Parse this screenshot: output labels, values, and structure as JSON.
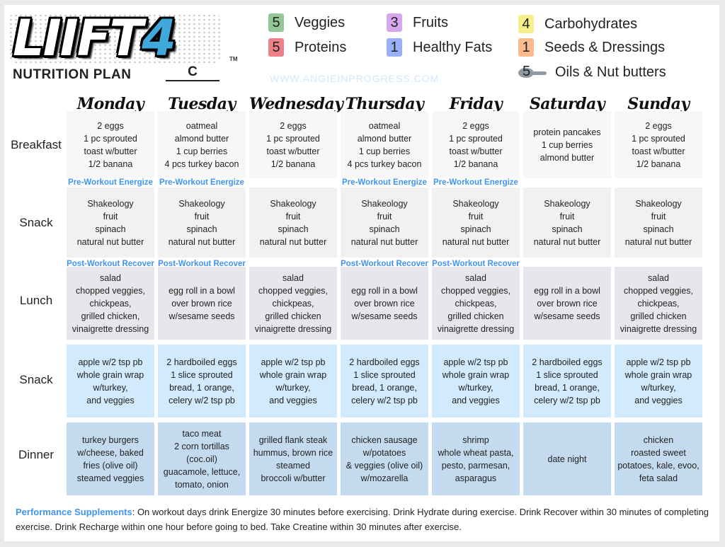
{
  "header": {
    "logo_main": "LIIFT",
    "logo_number": "4",
    "logo_tm": "TM",
    "plan_label": "NUTRITION PLAN",
    "plan_value": "C",
    "website": "WWW.ANGIEINPROGRESS.COM"
  },
  "legend": [
    {
      "count": "5",
      "label": "Veggies",
      "color": "#93c795"
    },
    {
      "count": "3",
      "label": "Fruits",
      "color": "#d7a7ec"
    },
    {
      "count": "4",
      "label": "Carbohydrates",
      "color": "#f5f08b"
    },
    {
      "count": "5",
      "label": "Proteins",
      "color": "#ee8089"
    },
    {
      "count": "1",
      "label": "Healthy Fats",
      "color": "#9aaff7"
    },
    {
      "count": "1",
      "label": "Seeds & Dressings",
      "color": "#fcbb8f"
    },
    {
      "count": "5",
      "label": "Oils & Nut butters",
      "color": "#8e9ba5"
    }
  ],
  "days": [
    "Monday",
    "Tuesday",
    "Wednesday",
    "Thursday",
    "Friday",
    "Saturday",
    "Sunday"
  ],
  "rows": [
    {
      "label": "Breakfast",
      "cells": [
        "2 eggs\n1 pc sprouted\ntoast w/butter\n1/2 banana",
        "oatmeal\nalmond butter\n1 cup berries\n4 pcs turkey bacon",
        "2 eggs\n1 pc sprouted\ntoast w/butter\n1/2 banana",
        "oatmeal\nalmond butter\n1 cup berries\n4 pcs turkey bacon",
        "2 eggs\n1 pc sprouted\ntoast w/butter\n1/2 banana",
        "protein pancakes\n1 cup berries\nalmond butter",
        "2 eggs\n1 pc sprouted\ntoast w/butter\n1/2 banana"
      ]
    },
    {
      "label": "Snack",
      "cells": [
        "Shakeology\nfruit\nspinach\nnatural nut butter",
        "Shakeology\nfruit\nspinach\nnatural nut butter",
        "Shakeology\nfruit\nspinach\nnatural nut butter",
        "Shakeology\nfruit\nspinach\nnatural nut butter",
        "Shakeology\nfruit\nspinach\nnatural nut butter",
        "Shakeology\nfruit\nspinach\nnatural nut butter",
        "Shakeology\nfruit\nspinach\nnatural nut butter"
      ]
    },
    {
      "label": "Lunch",
      "cells": [
        "salad\nchopped veggies,\nchickpeas,\ngrilled chicken,\nvinaigrette dressing",
        "egg roll in a bowl\nover brown rice\nw/sesame seeds",
        "salad\nchopped veggies,\nchickpeas,\ngrilled chicken\nvinaigrette dressing",
        "egg roll in a bowl\nover brown rice\nw/sesame seeds",
        "salad\nchopped veggies,\nchickpeas,\ngrilled chicken\nvinaigrette dressing",
        "egg roll in a bowl\nover brown rice\nw/sesame seeds",
        "salad\nchopped veggies,\nchickpeas,\ngrilled chicken\nvinaigrette dressing"
      ]
    },
    {
      "label": "Snack",
      "cells": [
        "apple w/2 tsp pb\nwhole grain wrap\nw/turkey,\nand veggies",
        "2 hardboiled eggs\n1 slice sprouted\nbread, 1 orange,\ncelery w/2 tsp pb",
        "apple w/2 tsp pb\nwhole grain wrap\nw/turkey,\nand veggies",
        "2 hardboiled eggs\n1 slice sprouted\nbread, 1 orange,\ncelery w/2 tsp pb",
        "apple w/2 tsp pb\nwhole grain wrap\nw/turkey,\nand veggies",
        "2 hardboiled eggs\n1 slice sprouted\nbread, 1 orange,\ncelery w/2 tsp pb",
        "apple w/2 tsp pb\nwhole grain wrap\nw/turkey,\nand veggies"
      ]
    },
    {
      "label": "Dinner",
      "cells": [
        "turkey burgers\nw/cheese, baked\nfries (olive oil)\nsteamed veggies",
        "taco meat\n2 corn tortillas\n(coc.oil)\nguacamole, lettuce,\ntomato, onion",
        "grilled flank steak\nhummus, brown rice\nsteamed\nbroccoli w/butter",
        "chicken sausage\nw/potatoes\n& veggies (olive oil)\nw/mozarella",
        "shrimp\nwhole wheat pasta,\npesto, parmesan,\nasparagus",
        "date night",
        "chicken\nroasted sweet\npotatoes, kale, evoo,\nfeta salad"
      ]
    }
  ],
  "pre_workout": {
    "label": "Pre-Workout Energize",
    "days": [
      true,
      true,
      false,
      true,
      true,
      false,
      false
    ]
  },
  "post_workout": {
    "label": "Post-Workout Recover",
    "days": [
      true,
      true,
      false,
      true,
      true,
      false,
      false
    ]
  },
  "footer": {
    "accent": "Performance Supplements",
    "text": ": On workout days drink Energize 30 minutes before exercising. Drink Hydrate during exercise. Drink Recover within 30 minutes of completing exercise. Drink Recharge within one hour before going to bed. Take Creatine within 30 minutes after exercise."
  }
}
